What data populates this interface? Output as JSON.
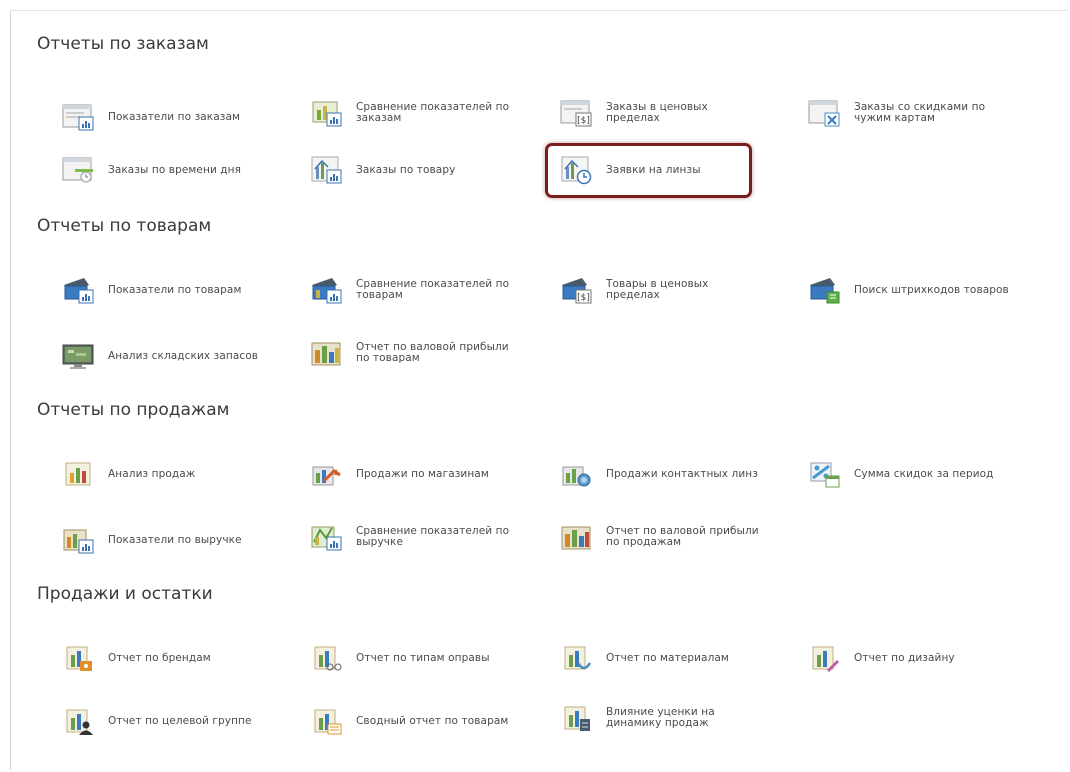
{
  "sections": [
    {
      "title": "Отчеты по заказам",
      "items": [
        {
          "label": "Показатели по заказам",
          "icon": "window-chart-icon"
        },
        {
          "label": "Сравнение показателей по\nзаказам",
          "icon": "compare-chart-icon"
        },
        {
          "label": "Заказы в ценовых\nпределах",
          "icon": "window-price-icon"
        },
        {
          "label": "Заказы со скидками по\nчужим картам",
          "icon": "window-discount-icon"
        },
        {
          "label": "Заказы по времени дня",
          "icon": "window-clock-icon"
        },
        {
          "label": "Заказы по товару",
          "icon": "bars-chart-icon"
        },
        {
          "label": "Заявки на линзы",
          "icon": "bars-clock-icon"
        }
      ]
    },
    {
      "title": "Отчеты по товарам",
      "items": [
        {
          "label": "Показатели по товарам",
          "icon": "scanner-chart-icon"
        },
        {
          "label": "Сравнение показателей по\nтоварам",
          "icon": "scanner-compare-icon"
        },
        {
          "label": "Товары в ценовых\nпределах",
          "icon": "scanner-price-icon"
        },
        {
          "label": "Поиск штрихкодов товаров",
          "icon": "scanner-search-icon"
        },
        {
          "label": "Анализ складских запасов",
          "icon": "monitor-stock-icon"
        },
        {
          "label": "Отчет по валовой прибыли\nпо товарам",
          "icon": "profit-chart-icon"
        }
      ]
    },
    {
      "title": "Отчеты по продажам",
      "items": [
        {
          "label": "Анализ продаж",
          "icon": "sales-chart-icon"
        },
        {
          "label": "Продажи по магазинам",
          "icon": "store-sales-icon"
        },
        {
          "label": "Продажи контактных линз",
          "icon": "lens-sales-icon"
        },
        {
          "label": "Сумма скидок за период",
          "icon": "discount-calendar-icon"
        },
        {
          "label": "Показатели по выручке",
          "icon": "revenue-chart-icon"
        },
        {
          "label": "Сравнение показателей по\nвыручке",
          "icon": "revenue-compare-icon"
        },
        {
          "label": "Отчет по валовой прибыли\nпо продажам",
          "icon": "profit-sales-icon"
        }
      ]
    },
    {
      "title": "Продажи и остатки",
      "items": [
        {
          "label": "Отчет по брендам",
          "icon": "brand-report-icon"
        },
        {
          "label": "Отчет по типам оправы",
          "icon": "frame-type-report-icon"
        },
        {
          "label": "Отчет по материалам",
          "icon": "material-report-icon"
        },
        {
          "label": "Отчет по дизайну",
          "icon": "design-report-icon"
        },
        {
          "label": "Отчет по целевой группе",
          "icon": "target-group-report-icon"
        },
        {
          "label": "Сводный отчет по товарам",
          "icon": "summary-report-icon"
        },
        {
          "label": "Влияние уценки на\nдинамику продаж",
          "icon": "markdown-impact-icon"
        }
      ]
    }
  ],
  "highlighted_item": "Заявки на линзы",
  "colors": {
    "highlight_border": "#7a1d1d",
    "title": "#3a3a3a",
    "label": "#4a4a4a"
  }
}
